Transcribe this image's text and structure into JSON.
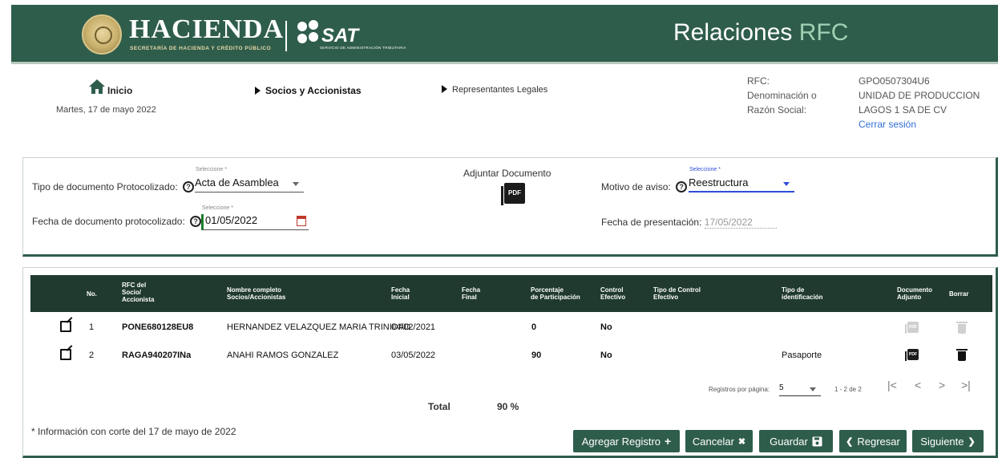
{
  "header": {
    "brand_name": "HACIENDA",
    "brand_sub": "SECRETARÍA DE HACIENDA Y CRÉDITO PÚBLICO",
    "sat_word": "SAT",
    "sat_sub": "SERVICIO DE ADMINISTRACIÓN TRIBUTARIA",
    "app_title_main": "Relaciones",
    "app_title_accent": "RFC"
  },
  "nav": {
    "home_label": "Inicio",
    "date": "Martes, 17 de mayo 2022",
    "step_socios": "Socios y Accionistas",
    "step_representantes": "Representantes Legales"
  },
  "user": {
    "rfc_label": "RFC:",
    "rfc_value": "GPO0507304U6",
    "denominacion_label_1": "Denominación o",
    "denominacion_label_2": "Razón Social:",
    "denominacion_value_1": "UNIDAD DE PRODUCCION",
    "denominacion_value_2": "LAGOS 1 SA DE CV",
    "logout": "Cerrar sesión"
  },
  "form": {
    "tipo_doc_label": "Tipo de documento Protocolizado:",
    "tipo_doc_caption": "Seleccione *",
    "tipo_doc_value": "Acta de Asamblea",
    "fecha_doc_label": "Fecha de documento protocolizado:",
    "fecha_doc_caption": "Seleccione *",
    "fecha_doc_value": "01/05/2022",
    "adjuntar_label": "Adjuntar Documento",
    "motivo_label": "Motivo de aviso:",
    "motivo_caption": "Seleccione *",
    "motivo_value": "Reestructura",
    "fecha_pres_label": "Fecha de presentación:",
    "fecha_pres_value": "17/05/2022",
    "help_glyph": "?",
    "pdf_text": "PDF"
  },
  "table": {
    "headers": {
      "no": "No.",
      "rfc_1": "RFC del",
      "rfc_2": "Socio/",
      "rfc_3": "Accionista",
      "nombre_1": "Nombre completo",
      "nombre_2": "Socios/Accionistas",
      "fecha_ini_1": "Fecha",
      "fecha_ini_2": "Inicial",
      "fecha_fin_1": "Fecha",
      "fecha_fin_2": "Final",
      "porc_1": "Porcentaje",
      "porc_2": "de Participación",
      "control_1": "Control",
      "control_2": "Efectivo",
      "tipo_control_1": "Tipo de Control",
      "tipo_control_2": "Efectivo",
      "tipo_id_1": "Tipo de",
      "tipo_id_2": "identificación",
      "doc_1": "Documento",
      "doc_2": "Adjunto",
      "borrar": "Borrar"
    },
    "rows": [
      {
        "no": "1",
        "rfc": "PONE680128EU8",
        "nombre": "HERNANDEZ VELAZQUEZ MARIA TRINIDAD",
        "fecha_inicial": "04/02/2021",
        "fecha_final": "",
        "porcentaje": "0",
        "control": "No",
        "tipo_control": "",
        "tipo_id": "",
        "doc_enabled": false
      },
      {
        "no": "2",
        "rfc": "RAGA940207INa",
        "nombre": "ANAHI RAMOS GONZALEZ",
        "fecha_inicial": "03/05/2022",
        "fecha_final": "",
        "porcentaje": "90",
        "control": "No",
        "tipo_control": "",
        "tipo_id": "Pasaporte",
        "doc_enabled": true
      }
    ],
    "pager": {
      "label": "Registros por página:",
      "page_size": "5",
      "range": "1 - 2 de 2",
      "first": "|<",
      "prev": "<",
      "next": ">",
      "last": ">|"
    },
    "total_label": "Total",
    "total_value": "90 %"
  },
  "footer": {
    "note": "* Información con corte del 17 de mayo de 2022"
  },
  "buttons": {
    "agregar": "Agregar Registro",
    "cancelar": "Cancelar",
    "guardar": "Guardar",
    "regresar": "Regresar",
    "siguiente": "Siguiente",
    "agregar_glyph": "+",
    "cancelar_glyph": "✖",
    "regresar_glyph": "❮",
    "siguiente_glyph": "❯"
  },
  "colors": {
    "brand_green": "#2f5d4c",
    "header_dark": "#203a2f",
    "accent_blue": "#2f4fd6"
  }
}
